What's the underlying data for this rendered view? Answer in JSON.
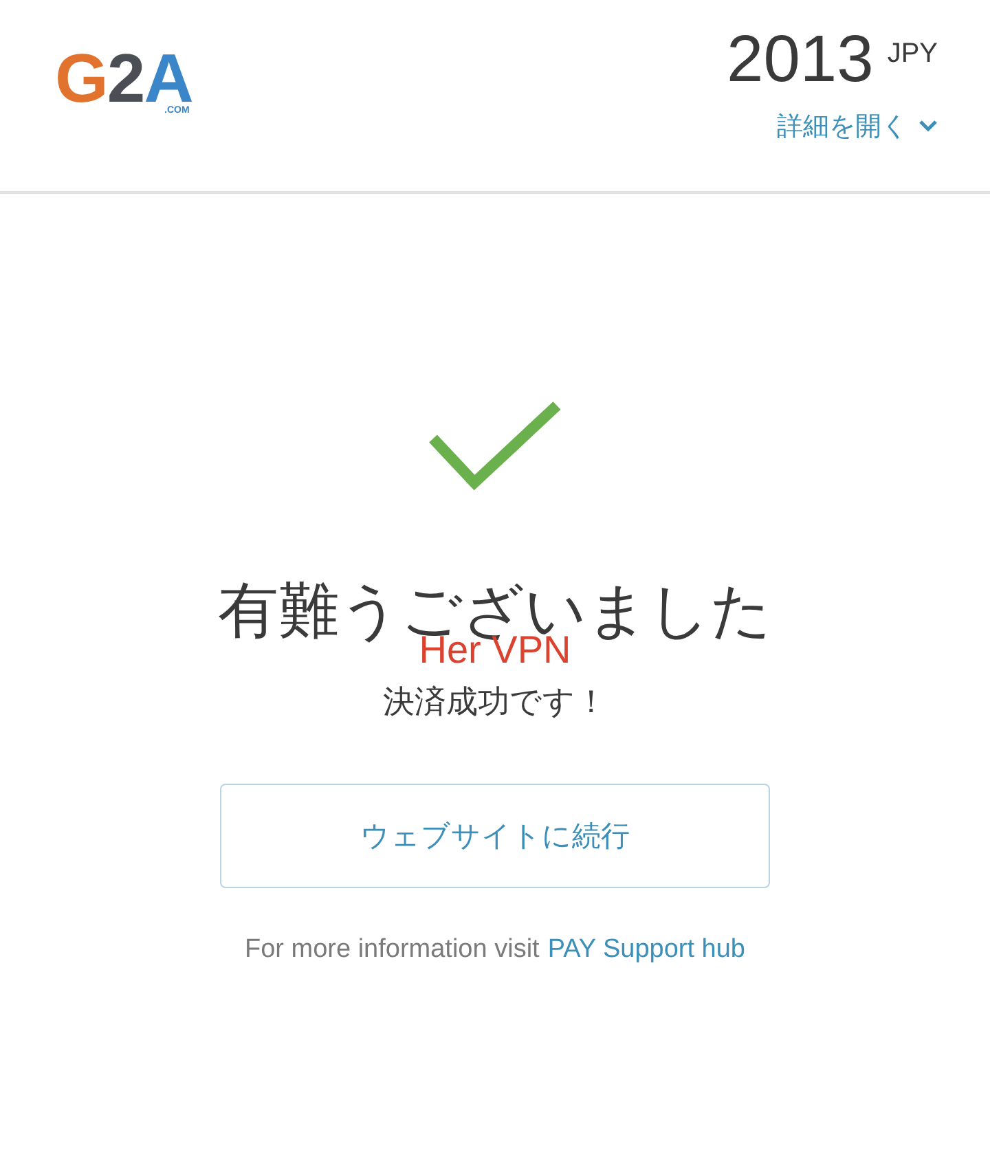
{
  "header": {
    "logo": {
      "letters": [
        {
          "text": "G",
          "color": "#e2732e"
        },
        {
          "text": "2",
          "color": "#4b4f55"
        },
        {
          "text": "A",
          "color": "#3a86c8"
        }
      ],
      "suffix": ".COM"
    },
    "amount": "2013",
    "currency": "JPY",
    "details_link": "詳細を開く"
  },
  "result": {
    "title": "有難うございました",
    "overlay_text": "Her VPN",
    "message": "決済成功です！",
    "button": "ウェブサイトに続行",
    "footer_text": "For more information visit",
    "footer_link": "PAY Support hub"
  }
}
